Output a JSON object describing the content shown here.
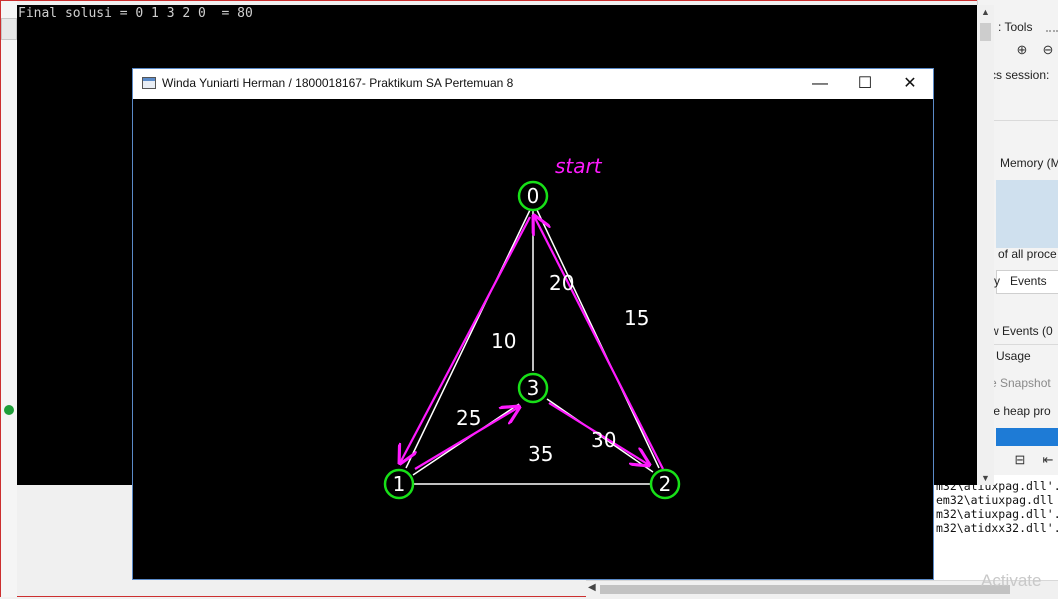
{
  "console": {
    "output_text": "Final solusi = 0 1 3 2 0  = 80"
  },
  "graph_window": {
    "title": "Winda Yuniarti Herman / 1800018167- Praktikum SA Pertemuan 8",
    "minimize_glyph": "—",
    "maximize_glyph": "☐",
    "close_glyph": "✕",
    "start_label": "start",
    "nodes": [
      {
        "id": "0",
        "label": "0"
      },
      {
        "id": "1",
        "label": "1"
      },
      {
        "id": "2",
        "label": "2"
      },
      {
        "id": "3",
        "label": "3"
      }
    ],
    "edge_weights": {
      "w03": "20",
      "w01": "10",
      "w02": "15",
      "w13": "25",
      "w12": "35",
      "w32": "30"
    },
    "tour": [
      "0",
      "1",
      "3",
      "2",
      "0"
    ],
    "colors": {
      "node": "#18e018",
      "edge": "#ffffff",
      "path": "#ff1aff",
      "label": "#ffffff",
      "background": "#000000"
    }
  },
  "diagnostics_panel": {
    "tools_label": ": Tools",
    "session_label": "tics session:",
    "memory_tab": "Memory (M",
    "processes_label": "of all proce",
    "tab_y": "y",
    "tab_events": "Events",
    "show_events": "w Events (0",
    "usage_label": "Usage",
    "snapshot_label": "e Snapshot",
    "heap_label": "ble heap pro"
  },
  "output_panel": {
    "lines": [
      "m32\\atiuxpag.dll'.",
      "em32\\atiuxpag.dll",
      "m32\\atiuxpag.dll'.",
      "m32\\atidxx32.dll'."
    ]
  },
  "watermark": "Activate"
}
